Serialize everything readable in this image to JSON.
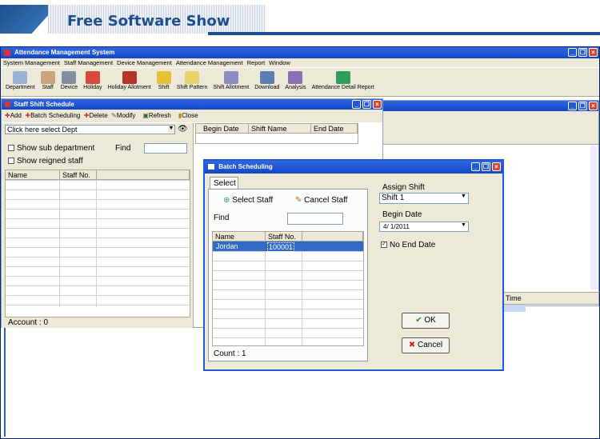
{
  "banner": {
    "title": "Free Software Show"
  },
  "app": {
    "title": "Attendance Management System",
    "menu": [
      "System Management",
      "Staff Management",
      "Device Management",
      "Attendance Management",
      "Report",
      "Window"
    ],
    "toolbar": [
      "Department",
      "Staff",
      "Device",
      "Holiday",
      "Holiday Allotment",
      "Shift",
      "Shift Pattern",
      "Shift Allotment",
      "Download",
      "Analysis",
      "Attendance Detail Report"
    ]
  },
  "schedule": {
    "title": "Staff Shift Schedule",
    "buttons": {
      "add": "Add",
      "batch": "Batch Scheduling",
      "delete": "Delete",
      "modify": "Modify",
      "refresh": "Refresh",
      "close": "Close"
    },
    "dept_placeholder": "Click here select Dept",
    "show_sub": "Show sub department",
    "show_resigned": "Show reigned staff",
    "find_label": "Find",
    "columns": [
      "Name",
      "Staff No."
    ],
    "account": "Account : 0",
    "sched_columns": [
      "Begin Date",
      "Shift Name",
      "End Date"
    ]
  },
  "right_panel": {
    "time_label": "Time"
  },
  "batch": {
    "title": "Batch Scheduling",
    "tab": "Select",
    "select_staff": "Select Staff",
    "cancel_staff": "Cancel Staff",
    "find_label": "Find",
    "columns": [
      "Name",
      "Staff No."
    ],
    "rows": [
      {
        "name": "Jordan",
        "no": "100001"
      }
    ],
    "count": "Count : 1",
    "assign_shift_label": "Assign Shift",
    "assign_shift_value": "Shift 1",
    "begin_date_label": "Begin Date",
    "begin_date_value": "4/ 1/2011",
    "no_end_date": "No End Date",
    "ok": "OK",
    "cancel": "Cancel"
  },
  "colors": {
    "titlebar": "#2459d6",
    "chrome": "#ece9d8",
    "banner": "#1f4e8c"
  }
}
